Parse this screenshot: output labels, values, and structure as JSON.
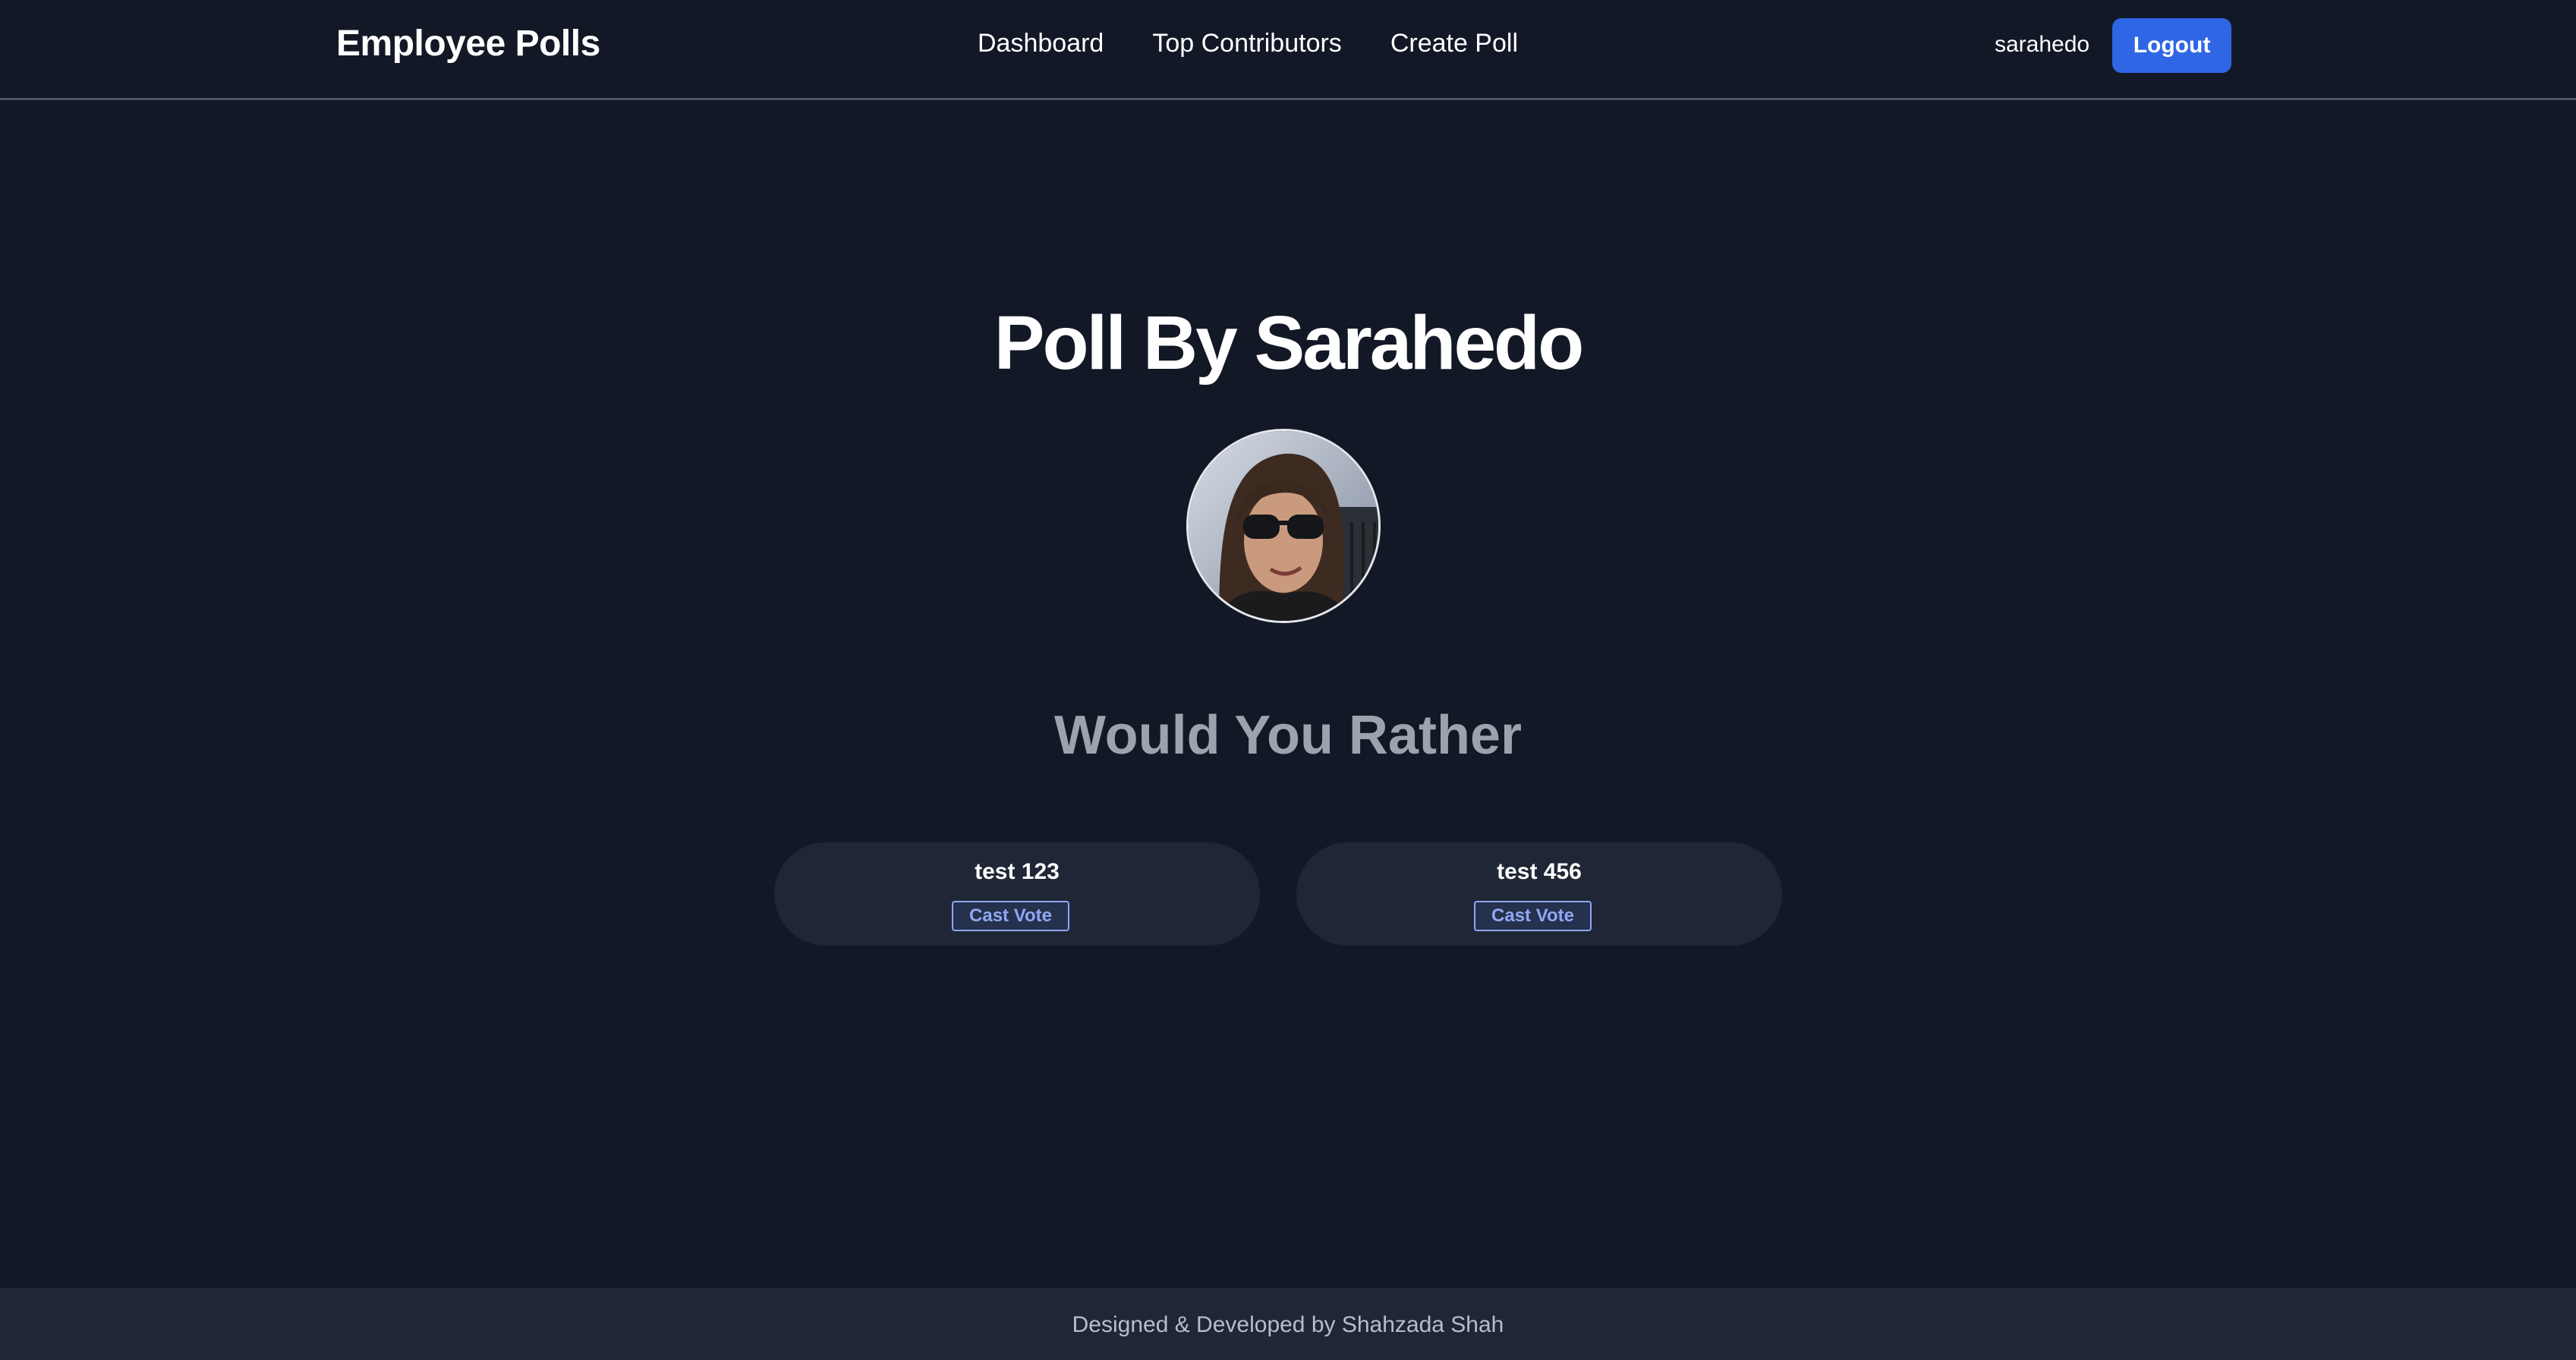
{
  "header": {
    "brand": "Employee Polls",
    "nav": [
      {
        "label": "Dashboard"
      },
      {
        "label": "Top Contributors"
      },
      {
        "label": "Create Poll"
      }
    ],
    "username": "sarahedo",
    "logout_label": "Logout"
  },
  "poll": {
    "title": "Poll By Sarahedo",
    "question": "Would You Rather",
    "options": [
      {
        "text": "test 123",
        "button_label": "Cast Vote"
      },
      {
        "text": "test 456",
        "button_label": "Cast Vote"
      }
    ]
  },
  "footer": {
    "text": "Designed & Developed by Shahzada Shah"
  },
  "colors": {
    "background": "#121826",
    "accent": "#2f66e6",
    "card": "#1f2635",
    "muted_text": "#9ca3af",
    "vote_button": "#8fa7f5"
  }
}
